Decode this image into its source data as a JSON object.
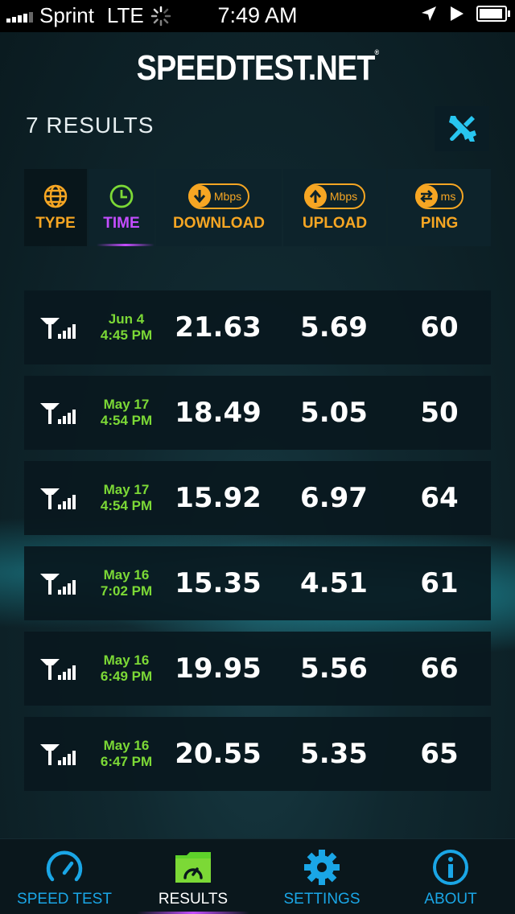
{
  "status_bar": {
    "carrier": "Sprint",
    "network": "LTE",
    "time": "7:49 AM"
  },
  "app": {
    "logo": "SPEEDTEST.NET"
  },
  "results_count": "7 RESULTS",
  "columns": {
    "type": "TYPE",
    "time": "TIME",
    "download": "DOWNLOAD",
    "download_unit": "Mbps",
    "upload": "UPLOAD",
    "upload_unit": "Mbps",
    "ping": "PING",
    "ping_unit": "ms"
  },
  "rows": [
    {
      "date": "Jun 4",
      "time": "4:45 PM",
      "download": "21.63",
      "upload": "5.69",
      "ping": "60"
    },
    {
      "date": "May 17",
      "time": "4:54 PM",
      "download": "18.49",
      "upload": "5.05",
      "ping": "50"
    },
    {
      "date": "May 17",
      "time": "4:54 PM",
      "download": "15.92",
      "upload": "6.97",
      "ping": "64"
    },
    {
      "date": "May 16",
      "time": "7:02 PM",
      "download": "15.35",
      "upload": "4.51",
      "ping": "61"
    },
    {
      "date": "May 16",
      "time": "6:49 PM",
      "download": "19.95",
      "upload": "5.56",
      "ping": "66"
    },
    {
      "date": "May 16",
      "time": "6:47 PM",
      "download": "20.55",
      "upload": "5.35",
      "ping": "65"
    }
  ],
  "tabs": [
    {
      "label": "SPEED TEST",
      "icon": "speedometer-icon"
    },
    {
      "label": "RESULTS",
      "icon": "results-folder-icon",
      "active": true
    },
    {
      "label": "SETTINGS",
      "icon": "gear-icon"
    },
    {
      "label": "ABOUT",
      "icon": "info-icon"
    }
  ],
  "colors": {
    "accent_orange": "#f6a623",
    "accent_purple": "#c44dff",
    "date_green": "#7cd936",
    "tab_blue": "#1aa6e6"
  }
}
